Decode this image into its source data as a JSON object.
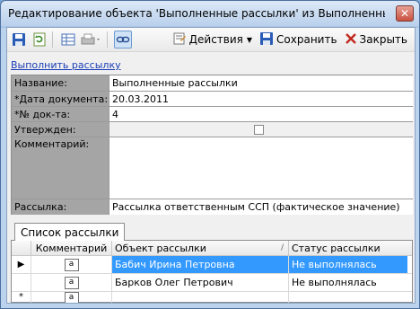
{
  "window": {
    "title": "Редактирование объекта 'Выполненные рассылки' из Выполненные рассылки",
    "close_glyph": "✕"
  },
  "toolbar": {
    "actions_label": "Действия",
    "save_label": "Сохранить",
    "close_label": "Закрыть"
  },
  "link": {
    "run_label": "Выполнить рассылку"
  },
  "form": {
    "name_label": "Название:",
    "name_value": "Выполненные рассылки",
    "date_label": "*Дата документа:",
    "date_value": "20.03.2011",
    "number_label": "*№ док-та:",
    "number_value": "4",
    "approved_label": "Утвержден:",
    "approved_checked": false,
    "comment_label": "Комментарий:",
    "comment_value": "",
    "mailing_label": "Рассылка:",
    "mailing_value": "Рассылка ответственным ССП (фактическое значение)"
  },
  "tabs": [
    {
      "label": "Список рассылки"
    }
  ],
  "grid": {
    "columns": [
      "Комментарий",
      "Объект рассылки",
      "Статус рассылки"
    ],
    "sort_indicator": "/",
    "row_marker": "▶",
    "new_row_marker": "*",
    "memo_glyph": "a",
    "rows": [
      {
        "object": "Бабич Ирина Петровна",
        "status": "Не выполнялась"
      },
      {
        "object": "Барков Олег Петрович",
        "status": "Не выполнялась"
      }
    ]
  },
  "colors": {
    "selection": "#3399ff",
    "link": "#1a3db5",
    "close_button": "#c9513f"
  },
  "icons": [
    "save-icon",
    "refresh-icon",
    "table-icon",
    "print-icon",
    "link-icon",
    "actions-icon",
    "save-icon",
    "close-icon"
  ]
}
